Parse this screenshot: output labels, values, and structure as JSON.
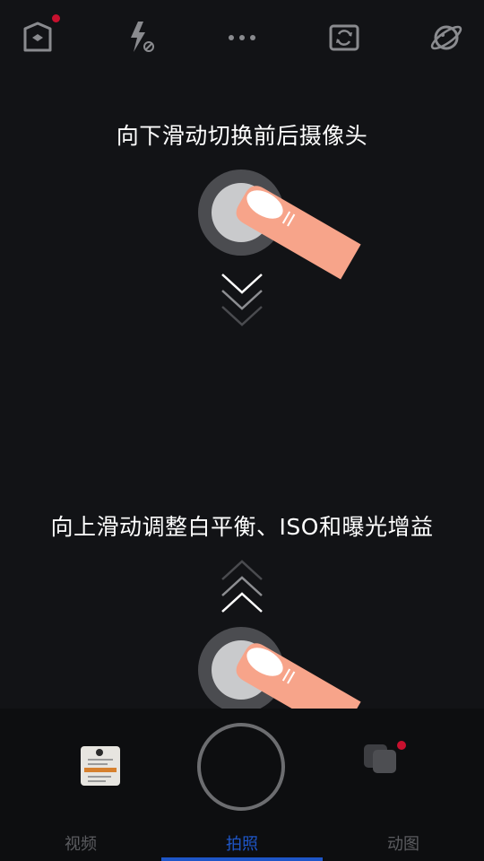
{
  "hints": {
    "swipe_down": "向下滑动切换前后摄像头",
    "swipe_up": "向上滑动调整白平衡、ISO和曝光增益"
  },
  "tabs": [
    {
      "label": "视频",
      "active": false
    },
    {
      "label": "拍照",
      "active": true
    },
    {
      "label": "动图",
      "active": false
    }
  ],
  "top_bar_icons": [
    "settings-house-icon",
    "flash-off-icon",
    "more-dots-icon",
    "switch-camera-icon",
    "planet-icon"
  ],
  "colors": {
    "background": "#121316",
    "accent": "#1e56c8",
    "badge": "#c8102e",
    "finger": "#f7a48a",
    "tab_inactive": "#5b5c60"
  }
}
